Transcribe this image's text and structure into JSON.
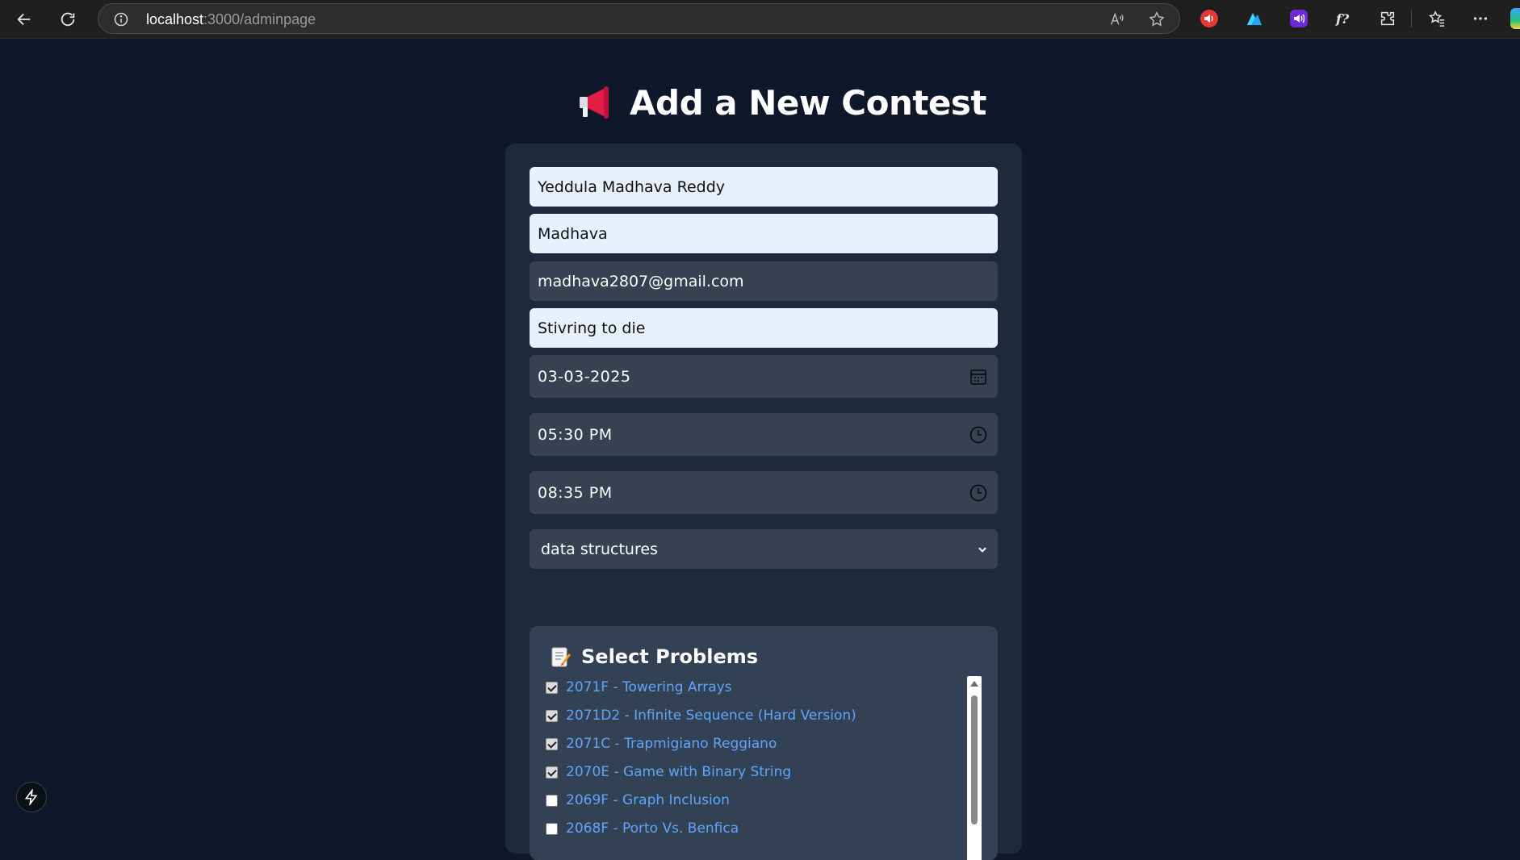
{
  "browser": {
    "url_host": "localhost",
    "url_path": ":3000/adminpage"
  },
  "page": {
    "title": "Add a New Contest",
    "title_icon": "megaphone-icon"
  },
  "form": {
    "full_name": "Yeddula Madhava Reddy",
    "username": "Madhava",
    "email": "madhava2807@gmail.com",
    "contest_name": "Stivring to die",
    "date": "03-03-2025",
    "start_time": "05:30 PM",
    "end_time": "08:35 PM",
    "category": "data structures"
  },
  "problems": {
    "heading": "Select Problems",
    "heading_icon": "memo-icon",
    "items": [
      {
        "label": "2071F - Towering Arrays",
        "checked": true
      },
      {
        "label": "2071D2 - Infinite Sequence (Hard Version)",
        "checked": true
      },
      {
        "label": "2071C - Trapmigiano Reggiano",
        "checked": true
      },
      {
        "label": "2070E - Game with Binary String",
        "checked": true
      },
      {
        "label": "2069F - Graph Inclusion",
        "checked": false
      },
      {
        "label": "2068F - Porto Vs. Benfica",
        "checked": false
      }
    ]
  },
  "colors": {
    "page_bg": "#0f172a",
    "card_bg": "#1e293b",
    "autofill_bg": "#e8f0fe",
    "input_bg": "#374151",
    "link": "#60a5fa"
  }
}
